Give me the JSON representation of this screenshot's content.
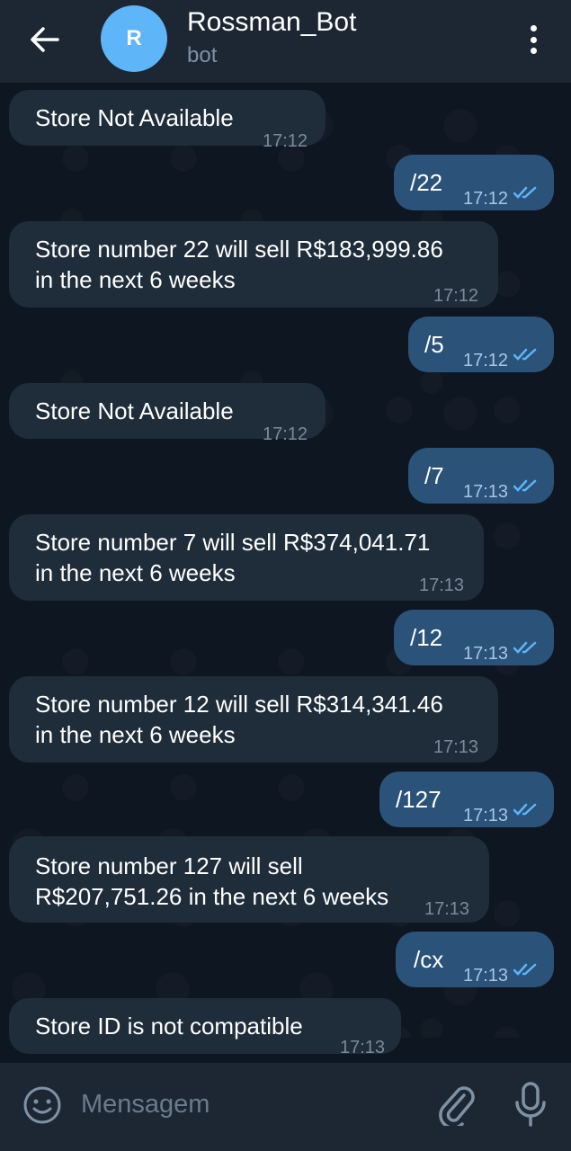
{
  "header": {
    "title": "Rossman_Bot",
    "subtitle": "bot",
    "avatar_letter": "R",
    "avatar_color": "#5eb5f7"
  },
  "messages": [
    {
      "dir": "in",
      "text": "Store Not Available",
      "time": "17:12"
    },
    {
      "dir": "out",
      "text": "/22",
      "time": "17:12",
      "read": true
    },
    {
      "dir": "in",
      "text_lines": [
        "Store number 22 will sell R$183,999.86",
        "in the next 6 weeks"
      ],
      "time": "17:12"
    },
    {
      "dir": "out",
      "text": "/5",
      "time": "17:12",
      "read": true
    },
    {
      "dir": "in",
      "text": "Store Not Available",
      "time": "17:12"
    },
    {
      "dir": "out",
      "text": "/7",
      "time": "17:13",
      "read": true
    },
    {
      "dir": "in",
      "text_lines": [
        "Store number 7 will sell R$374,041.71",
        "in the next 6 weeks"
      ],
      "time": "17:13"
    },
    {
      "dir": "out",
      "text": "/12",
      "time": "17:13",
      "read": true
    },
    {
      "dir": "in",
      "text_lines": [
        "Store number 12 will sell R$314,341.46",
        "in the next 6 weeks"
      ],
      "time": "17:13"
    },
    {
      "dir": "out",
      "text": "/127",
      "time": "17:13",
      "read": true
    },
    {
      "dir": "in",
      "text_lines": [
        "Store number 127 will sell",
        "R$207,751.26 in the next 6 weeks"
      ],
      "time": "17:13"
    },
    {
      "dir": "out",
      "text": "/cx",
      "time": "17:13",
      "read": true
    },
    {
      "dir": "in",
      "text": "Store ID is not compatible",
      "time": "17:13"
    }
  ],
  "composer": {
    "placeholder": "Mensagem",
    "icons": [
      "emoji-icon",
      "paperclip-icon",
      "microphone-icon"
    ]
  },
  "colors": {
    "background": "#0e1621",
    "header": "#1c2733",
    "incoming_bubble": "#1f2c3a",
    "outgoing_bubble": "#2b5278",
    "read_check": "#5eb5f7"
  }
}
